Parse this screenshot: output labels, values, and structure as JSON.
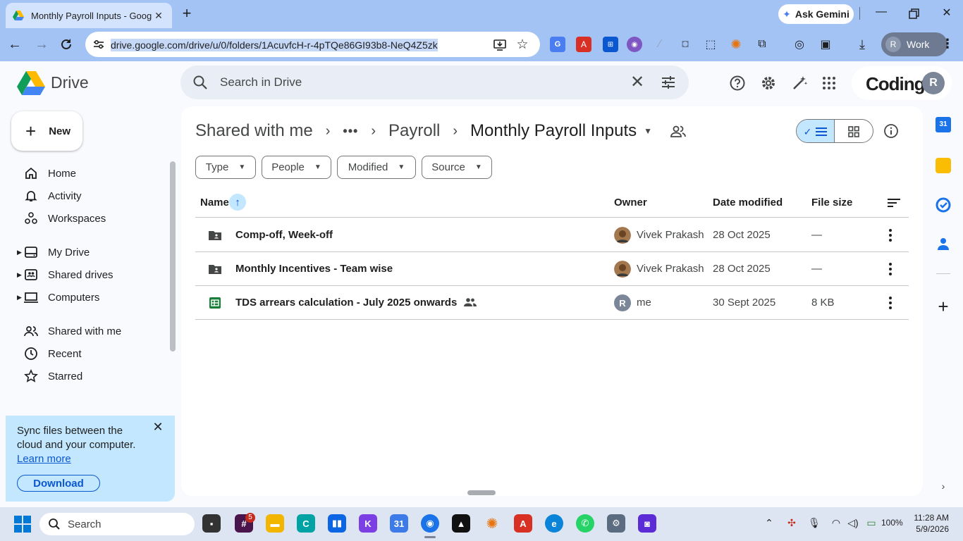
{
  "browser": {
    "tab_title": "Monthly Payroll Inputs - Google Drive",
    "url": "drive.google.com/drive/u/0/folders/1AcuvfcH-r-4pTQe86GI93b8-NeQ4Z5zk",
    "ask_gemini": "Ask Gemini",
    "profile_label": "Work",
    "profile_initial": "R"
  },
  "drive": {
    "app_name": "Drive",
    "search_placeholder": "Search in Drive",
    "org_brand": "Codingal",
    "user_initial": "R"
  },
  "sidebar": {
    "new_label": "New",
    "items": [
      {
        "label": "Home",
        "icon": "home-icon"
      },
      {
        "label": "Activity",
        "icon": "bell-icon"
      },
      {
        "label": "Workspaces",
        "icon": "workspaces-icon"
      },
      {
        "label": "My Drive",
        "icon": "my-drive-icon"
      },
      {
        "label": "Shared drives",
        "icon": "shared-drives-icon"
      },
      {
        "label": "Computers",
        "icon": "computer-icon"
      },
      {
        "label": "Shared with me",
        "icon": "people-icon"
      },
      {
        "label": "Recent",
        "icon": "clock-icon"
      },
      {
        "label": "Starred",
        "icon": "star-icon"
      }
    ],
    "promo": {
      "text": "Sync files between the cloud and your computer.",
      "link": "Learn more",
      "download": "Download"
    }
  },
  "breadcrumb": {
    "items": [
      "Shared with me",
      "Payroll",
      "Monthly Payroll Inputs"
    ]
  },
  "filters": [
    "Type",
    "People",
    "Modified",
    "Source"
  ],
  "table": {
    "columns": {
      "name": "Name",
      "owner": "Owner",
      "date": "Date modified",
      "size": "File size"
    },
    "rows": [
      {
        "name": "Comp-off, Week-off",
        "type": "shared-folder",
        "owner": "Vivek Prakash",
        "date": "28 Oct 2025",
        "size": "—"
      },
      {
        "name": "Monthly Incentives - Team wise",
        "type": "shared-folder",
        "owner": "Vivek Prakash",
        "date": "28 Oct 2025",
        "size": "—"
      },
      {
        "name": "TDS arrears calculation - July 2025 onwards",
        "type": "spreadsheet",
        "owner": "me",
        "owner_initial": "R",
        "date": "30 Sept 2025",
        "size": "8 KB"
      }
    ]
  },
  "taskbar": {
    "search_label": "Search",
    "slack_badge": "5",
    "battery": "100%",
    "time": "11:28 AM",
    "date": "5/9/2026"
  },
  "colors": {
    "accent": "#0b57d0",
    "selected": "#c2e7ff",
    "sheets_green": "#188038"
  }
}
